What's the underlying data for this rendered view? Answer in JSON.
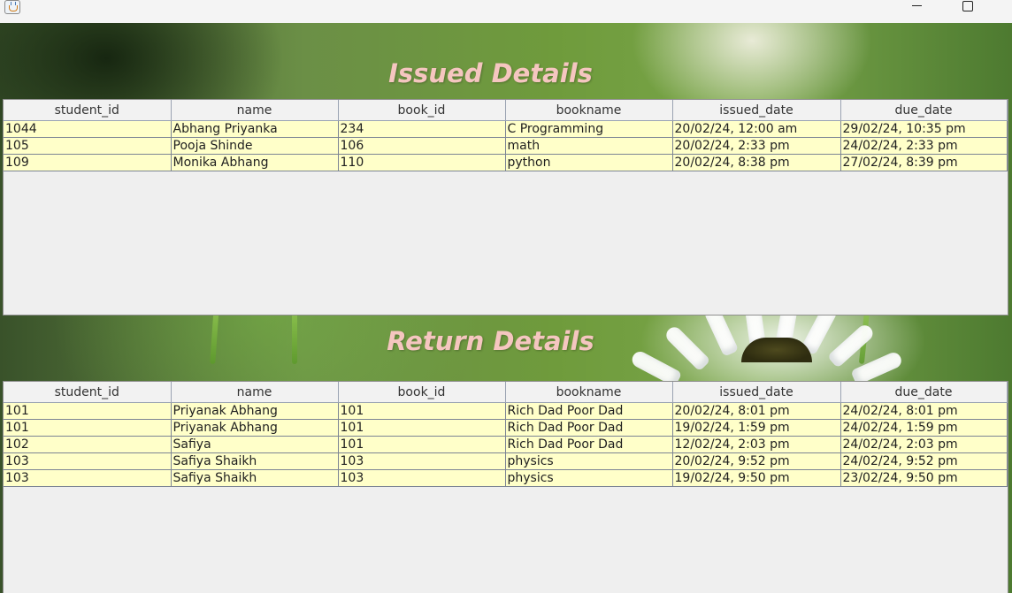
{
  "window": {
    "app_icon": "java-cup-icon",
    "controls": [
      "minimize-icon",
      "maximize-icon"
    ]
  },
  "issued": {
    "title": "Issued Details",
    "columns": [
      "student_id",
      "name",
      "book_id",
      "bookname",
      "issued_date",
      "due_date"
    ],
    "rows": [
      [
        "1044",
        "Abhang Priyanka",
        "234",
        "C Programming",
        "20/02/24, 12:00 am",
        "29/02/24, 10:35 pm"
      ],
      [
        "105",
        "Pooja Shinde",
        "106",
        "math",
        "20/02/24, 2:33 pm",
        "24/02/24, 2:33 pm"
      ],
      [
        "109",
        "Monika Abhang",
        "110",
        "python",
        "20/02/24, 8:38 pm",
        "27/02/24, 8:39 pm"
      ]
    ]
  },
  "returned": {
    "title": "Return Details",
    "columns": [
      "student_id",
      "name",
      "book_id",
      "bookname",
      "issued_date",
      "due_date"
    ],
    "rows": [
      [
        "101",
        "Priyanak Abhang",
        "101",
        "Rich Dad Poor Dad",
        "20/02/24, 8:01 pm",
        "24/02/24, 8:01 pm"
      ],
      [
        "101",
        "Priyanak Abhang",
        "101",
        "Rich Dad Poor Dad",
        "19/02/24, 1:59 pm",
        "24/02/24, 1:59 pm"
      ],
      [
        "102",
        "Safiya",
        "101",
        "Rich Dad Poor Dad",
        "12/02/24, 2:03 pm",
        "24/02/24, 2:03 pm"
      ],
      [
        "103",
        "Safiya Shaikh",
        "103",
        "physics",
        "20/02/24, 9:52 pm",
        "24/02/24, 9:52 pm"
      ],
      [
        "103",
        "Safiya Shaikh",
        "103",
        "physics",
        "19/02/24, 9:50 pm",
        "23/02/24, 9:50 pm"
      ]
    ]
  },
  "colors": {
    "title_text": "#f5c6c0",
    "row_background": "#ffffc9",
    "header_background": "#f2f2f2",
    "panel_background": "#efefef"
  }
}
